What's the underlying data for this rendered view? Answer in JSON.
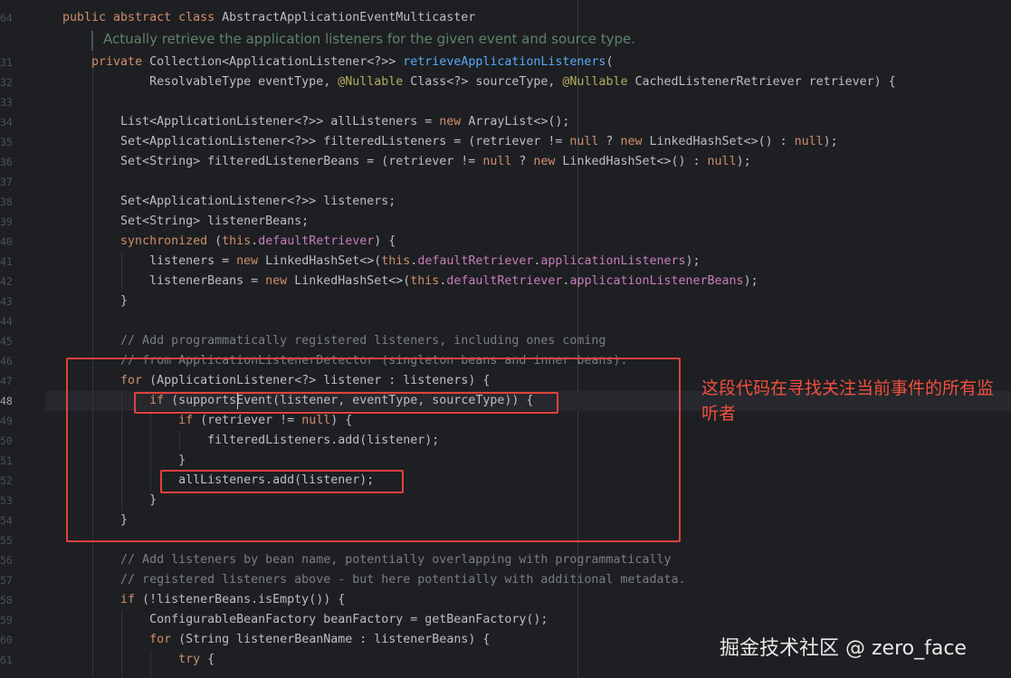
{
  "header": {
    "line_number": "64",
    "code": "public abstract class AbstractApplicationEventMulticaster"
  },
  "doc_comment": "Actually retrieve the application listeners for the given event and source type.",
  "lines": [
    {
      "n": "31",
      "text": "    private Collection<ApplicationListener<?>> retrieveApplicationListeners("
    },
    {
      "n": "32",
      "text": "            ResolvableType eventType, @Nullable Class<?> sourceType, @Nullable CachedListenerRetriever retriever) {"
    },
    {
      "n": "33",
      "text": ""
    },
    {
      "n": "34",
      "text": "        List<ApplicationListener<?>> allListeners = new ArrayList<>();"
    },
    {
      "n": "35",
      "text": "        Set<ApplicationListener<?>> filteredListeners = (retriever != null ? new LinkedHashSet<>() : null);"
    },
    {
      "n": "36",
      "text": "        Set<String> filteredListenerBeans = (retriever != null ? new LinkedHashSet<>() : null);"
    },
    {
      "n": "37",
      "text": ""
    },
    {
      "n": "38",
      "text": "        Set<ApplicationListener<?>> listeners;"
    },
    {
      "n": "39",
      "text": "        Set<String> listenerBeans;"
    },
    {
      "n": "40",
      "text": "        synchronized (this.defaultRetriever) {"
    },
    {
      "n": "41",
      "text": "            listeners = new LinkedHashSet<>(this.defaultRetriever.applicationListeners);"
    },
    {
      "n": "42",
      "text": "            listenerBeans = new LinkedHashSet<>(this.defaultRetriever.applicationListenerBeans);"
    },
    {
      "n": "43",
      "text": "        }"
    },
    {
      "n": "44",
      "text": ""
    },
    {
      "n": "45",
      "text": "        // Add programmatically registered listeners, including ones coming"
    },
    {
      "n": "46",
      "text": "        // from ApplicationListenerDetector (singleton beans and inner beans)."
    },
    {
      "n": "47",
      "text": "        for (ApplicationListener<?> listener : listeners) {"
    },
    {
      "n": "48",
      "text": "            if (supportsEvent(listener, eventType, sourceType)) {"
    },
    {
      "n": "49",
      "text": "                if (retriever != null) {"
    },
    {
      "n": "50",
      "text": "                    filteredListeners.add(listener);"
    },
    {
      "n": "51",
      "text": "                }"
    },
    {
      "n": "52",
      "text": "                allListeners.add(listener);"
    },
    {
      "n": "53",
      "text": "            }"
    },
    {
      "n": "54",
      "text": "        }"
    },
    {
      "n": "55",
      "text": ""
    },
    {
      "n": "56",
      "text": "        // Add listeners by bean name, potentially overlapping with programmatically"
    },
    {
      "n": "57",
      "text": "        // registered listeners above - but here potentially with additional metadata."
    },
    {
      "n": "58",
      "text": "        if (!listenerBeans.isEmpty()) {"
    },
    {
      "n": "59",
      "text": "            ConfigurableBeanFactory beanFactory = getBeanFactory();"
    },
    {
      "n": "60",
      "text": "            for (String listenerBeanName : listenerBeans) {"
    },
    {
      "n": "61",
      "text": "                try {"
    }
  ],
  "current_line": "48",
  "annotation_note": "这段代码在寻找关注当前事件的所有监听者",
  "watermark": "掘金技术社区 @ zero_face",
  "colors": {
    "background": "#1e1f22",
    "keyword": "#cf8e6d",
    "method": "#56a8f5",
    "field": "#c77dbb",
    "annotation": "#b3ae60",
    "comment": "#7a7e85",
    "doc": "#5f826b",
    "highlight_box": "#e0423d"
  }
}
